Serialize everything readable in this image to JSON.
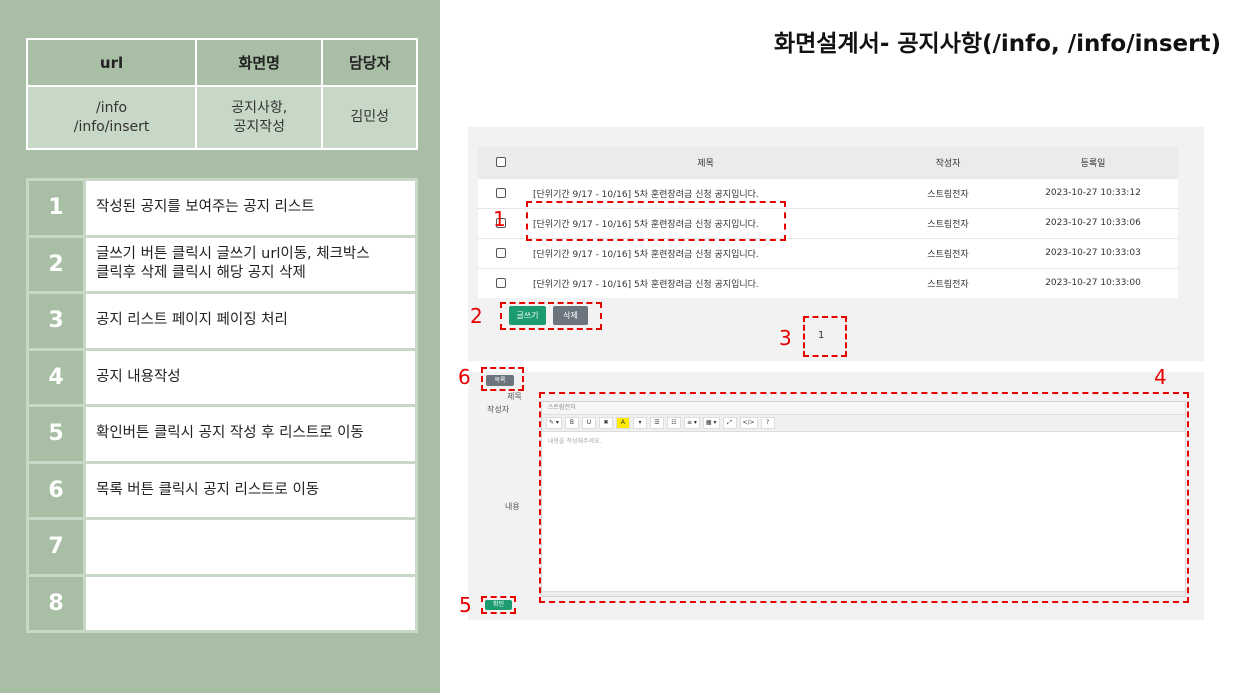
{
  "title": "화면설계서- 공지사항(/info, /info/insert)",
  "info_table": {
    "headers": [
      "url",
      "화면명",
      "담당자"
    ],
    "url_lines": [
      "/info",
      "/info/insert"
    ],
    "screen_lines": [
      "공지사항,",
      "공지작성"
    ],
    "owner": "김민성"
  },
  "items": [
    {
      "num": "1",
      "lines": [
        "작성된 공지를 보여주는 공지 리스트"
      ]
    },
    {
      "num": "2",
      "lines": [
        "글쓰기 버튼 클릭시 글쓰기 url이동, 체크박스",
        "클릭후 삭제 클릭시 해당 공지 삭제"
      ]
    },
    {
      "num": "3",
      "lines": [
        "공지 리스트 페이지 페이징 처리"
      ]
    },
    {
      "num": "4",
      "lines": [
        "공지 내용작성"
      ]
    },
    {
      "num": "5",
      "lines": [
        "확인버튼 클릭시 공지 작성 후 리스트로 이동"
      ]
    },
    {
      "num": "6",
      "lines": [
        "목록 버튼 클릭시 공지 리스트로 이동"
      ]
    },
    {
      "num": "7",
      "lines": [
        ""
      ]
    },
    {
      "num": "8",
      "lines": [
        ""
      ]
    }
  ],
  "mock_list": {
    "headers": [
      "제목",
      "작성자",
      "등록일"
    ],
    "rows": [
      {
        "title": "[단위기간 9/17 - 10/16] 5차 훈련장려금 신청 공지입니다.",
        "writer": "스트림전자",
        "date": "2023-10-27 10:33:12"
      },
      {
        "title": "[단위기간 9/17 - 10/16] 5차 훈련장려금 신청 공지입니다.",
        "writer": "스트림전자",
        "date": "2023-10-27 10:33:06"
      },
      {
        "title": "[단위기간 9/17 - 10/16] 5차 훈련장려금 신청 공지입니다.",
        "writer": "스트림전자",
        "date": "2023-10-27 10:33:03"
      },
      {
        "title": "[단위기간 9/17 - 10/16] 5차 훈련장려금 신청 공지입니다.",
        "writer": "스트림전자",
        "date": "2023-10-27 10:33:00"
      }
    ],
    "write_button": "글쓰기",
    "delete_button": "삭제",
    "page": "1"
  },
  "mock_editor": {
    "list_button": "목록",
    "label_title": "제목",
    "label_writer": "작성자",
    "label_content": "내용",
    "writer_value": "스트림전자",
    "placeholder": "내용을 작성해주세요.",
    "confirm_button": "확인",
    "toolbar": [
      "✎ ▾",
      "B",
      "U",
      "✖",
      "A",
      "▾",
      "☰",
      "☷",
      "≡ ▾",
      "▦ ▾",
      "⤢",
      "</>",
      "?"
    ]
  },
  "annotations": [
    "1",
    "2",
    "3",
    "4",
    "5",
    "6"
  ],
  "colors": {
    "panel": "#a8bfa5",
    "panel_light": "#c8d8c6",
    "annotation": "#e60000",
    "primary_button": "#1b9b6e",
    "secondary_button": "#6c757d"
  }
}
